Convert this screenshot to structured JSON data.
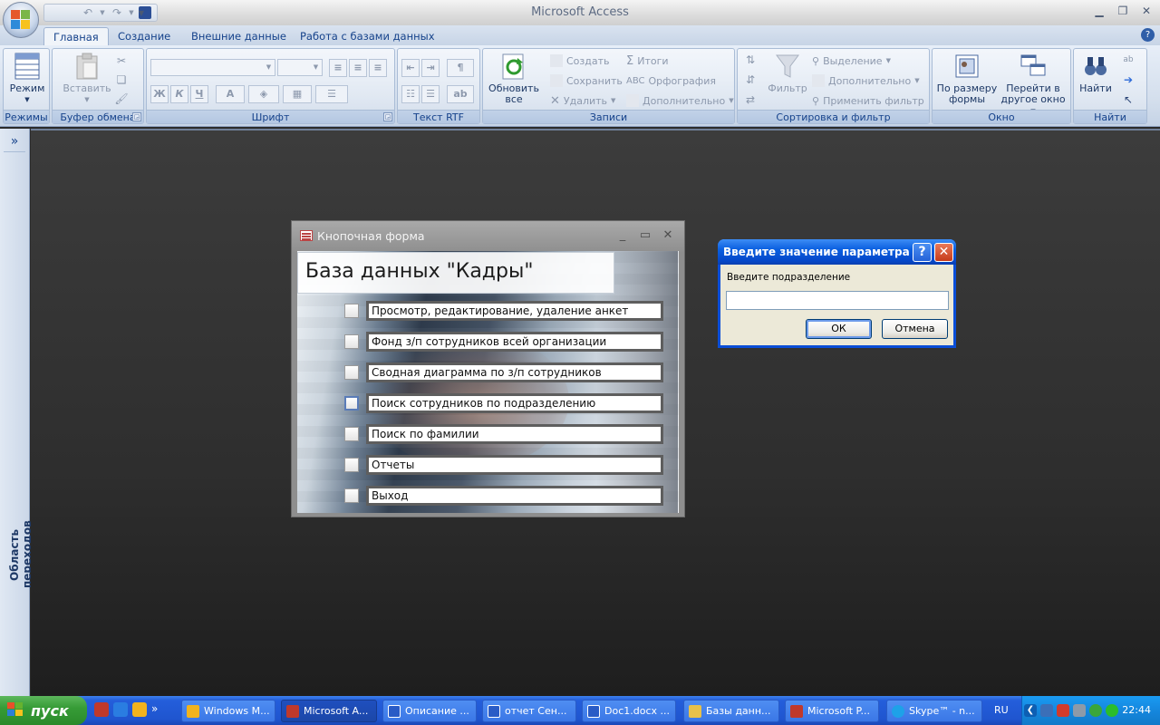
{
  "app": {
    "title": "Microsoft Access"
  },
  "ribbon": {
    "tabs": [
      "Главная",
      "Создание",
      "Внешние данные",
      "Работа с базами данных"
    ],
    "active_tab": "Главная",
    "groups": {
      "views": {
        "label": "Режимы",
        "mode_button": "Режим"
      },
      "clipboard": {
        "label": "Буфер обмена",
        "paste_button": "Вставить"
      },
      "font": {
        "label": "Шрифт",
        "bold": "Ж",
        "italic": "К",
        "underline": "Ч",
        "font_color": "А"
      },
      "rtf": {
        "label": "Текст RTF"
      },
      "records": {
        "label": "Записи",
        "refresh_button": "Обновить все",
        "create": "Создать",
        "save": "Сохранить",
        "delete": "Удалить",
        "totals": "Итоги",
        "spelling": "Орфография",
        "more": "Дополнительно"
      },
      "sort": {
        "label": "Сортировка и фильтр",
        "filter_button": "Фильтр",
        "selection": "Выделение",
        "advanced": "Дополнительно",
        "toggle_filter": "Применить фильтр"
      },
      "window": {
        "label": "Окно",
        "fit_form": "По размеру формы",
        "switch_window": "Перейти в другое окно"
      },
      "find": {
        "label": "Найти",
        "find_button": "Найти"
      }
    }
  },
  "nav_pane": {
    "toggle": "»",
    "label": "Область переходов"
  },
  "switchboard": {
    "window_title": "Кнопочная форма",
    "header": "База данных \"Кадры\"",
    "items": [
      "Просмотр, редактирование, удаление анкет",
      "Фонд з/п сотрудников всей организации",
      "Сводная диаграмма по з/п сотрудников",
      "Поиск сотрудников по подразделению",
      "Поиск по фамилии",
      "Отчеты",
      "Выход"
    ]
  },
  "param_dialog": {
    "title": "Введите значение параметра",
    "prompt": "Введите подразделение",
    "value": "",
    "ok": "ОК",
    "cancel": "Отмена",
    "help": "?",
    "close": "✕"
  },
  "taskbar": {
    "start": "пуск",
    "quicklaunch_more": "»",
    "items": [
      {
        "label": "Windows M...",
        "color": "#f2b31d"
      },
      {
        "label": "Microsoft A...",
        "color": "#c0392b",
        "active": true
      },
      {
        "label": "Описание ...",
        "color": "#2a5cc6"
      },
      {
        "label": "отчет Сен...",
        "color": "#2a5cc6"
      },
      {
        "label": "Doc1.docx ...",
        "color": "#2a5cc6"
      },
      {
        "label": "Базы данн...",
        "color": "#e8c14a"
      },
      {
        "label": "Microsoft P...",
        "color": "#c0392b"
      },
      {
        "label": "Skype™ - n...",
        "color": "#1ea1e8"
      }
    ],
    "language": "RU",
    "clock": "22:44"
  }
}
